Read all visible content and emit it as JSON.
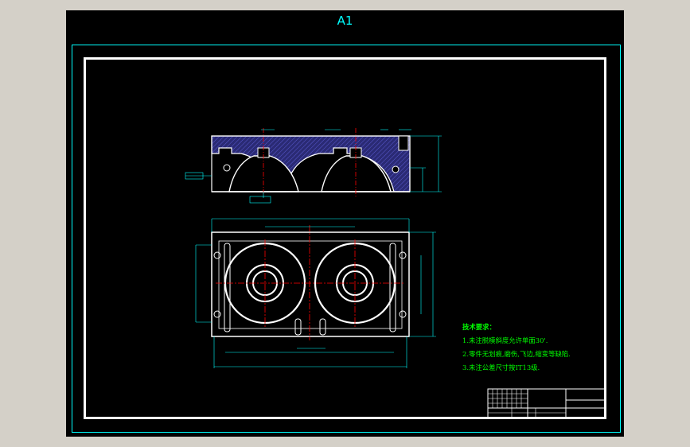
{
  "drawing": {
    "sheet_size": "A1",
    "colors": {
      "background": "#000000",
      "frame": "#ffffff",
      "outline": "#00ffff",
      "dimension": "#00ffff",
      "hatch": "#3f3f9c",
      "centerline": "#ff0000",
      "notes": "#00ff00"
    }
  },
  "technical_requirements": {
    "heading": "技术要求：",
    "items": [
      "1.未注脱模斜度允许单面30'.",
      "2.零件无划痕,磨伤,飞边,缩变等缺陷.",
      "3.未注公差尺寸按IT13级."
    ]
  },
  "title_block": {
    "present": true
  }
}
